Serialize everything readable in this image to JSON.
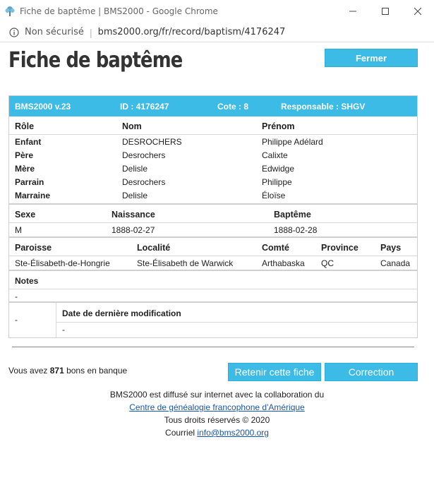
{
  "window": {
    "title": "Fiche de baptême | BMS2000 - Google Chrome",
    "controls": [
      "minimize",
      "maximize",
      "close"
    ]
  },
  "addressbar": {
    "security": "Non sécurisé",
    "url": "bms2000.org/fr/record/baptism/4176247"
  },
  "page": {
    "title": "Fiche de baptême",
    "close_button": "Fermer"
  },
  "record_header": {
    "version": "BMS2000 v.23",
    "id": "ID : 4176247",
    "cote": "Cote : 8",
    "responsable": "Responsable : SHGV"
  },
  "persons": {
    "headers": [
      "Rôle",
      "Nom",
      "Prénom"
    ],
    "rows": [
      {
        "role": "Enfant",
        "nom": "DESROCHERS",
        "prenom": "Philippe Adélard"
      },
      {
        "role": "Père",
        "nom": "Desrochers",
        "prenom": "Calixte"
      },
      {
        "role": "Mère",
        "nom": "Delisle",
        "prenom": "Edwidge"
      },
      {
        "role": "Parrain",
        "nom": "Desrochers",
        "prenom": "Philippe"
      },
      {
        "role": "Marraine",
        "nom": "Delisle",
        "prenom": "Éloïse"
      }
    ]
  },
  "dates": {
    "headers": [
      "Sexe",
      "Naissance",
      "Baptême"
    ],
    "values": [
      "M",
      "1888-02-27",
      "1888-02-28"
    ]
  },
  "place": {
    "headers": [
      "Paroisse",
      "Localité",
      "Comté",
      "Province",
      "Pays"
    ],
    "values": [
      "Ste-Élisabeth-de-Hongrie",
      "Ste-Élisabeth de Warwick",
      "Arthabaska",
      "QC",
      "Canada"
    ]
  },
  "notes": {
    "label": "Notes",
    "value": "-"
  },
  "modification": {
    "left_value": "-",
    "label": "Date de dernière modification",
    "value": "-"
  },
  "bank": {
    "prefix": "Vous avez ",
    "count": "871",
    "suffix": " bons en banque"
  },
  "actions": {
    "save": "Retenir cette fiche",
    "correction": "Correction"
  },
  "footer": {
    "line1": "BMS2000 est diffusé sur internet avec la collaboration du",
    "link1": "Centre de généalogie francophone d'Amérique",
    "line3": "Tous droits réservés © 2020",
    "line4_prefix": "Courriel ",
    "email": "info@bms2000.org"
  },
  "colors": {
    "accent": "#3bbbe6",
    "link": "#1a56a6"
  }
}
